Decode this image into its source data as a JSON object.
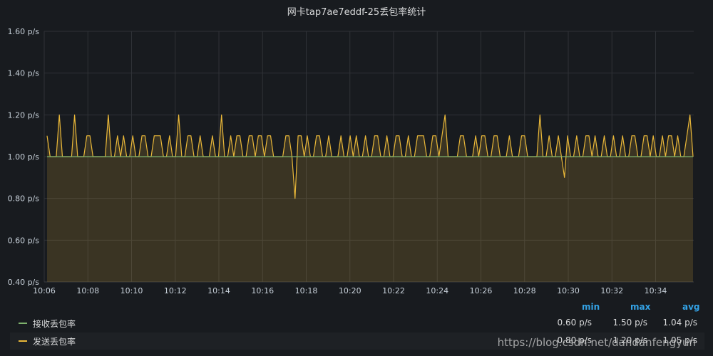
{
  "panel": {
    "title": "网卡tap7ae7eddf-25丢包率统计"
  },
  "chart_data": {
    "type": "line",
    "y_unit_suffix": " p/s",
    "ylim": [
      0.4,
      1.6
    ],
    "yticks": [
      "1.60 p/s",
      "1.40 p/s",
      "1.20 p/s",
      "1.00 p/s",
      "0.80 p/s",
      "0.60 p/s",
      "0.40 p/s"
    ],
    "ytick_values": [
      1.6,
      1.4,
      1.2,
      1.0,
      0.8,
      0.6,
      0.4
    ],
    "xticks": [
      "10:06",
      "10:08",
      "10:10",
      "10:12",
      "10:14",
      "10:16",
      "10:18",
      "10:20",
      "10:22",
      "10:24",
      "10:26",
      "10:28",
      "10:30",
      "10:32",
      "10:34"
    ],
    "grid": true,
    "series": [
      {
        "name": "接收丢包率",
        "color": "#7eb26d",
        "fill": false,
        "values": [
          1.0,
          1.0,
          1.0,
          1.0,
          1.0,
          1.0,
          1.0,
          1.0,
          1.0,
          1.0,
          1.0,
          1.0,
          1.0,
          1.0,
          1.0,
          1.0,
          1.0,
          1.0,
          1.0,
          1.0,
          1.0,
          1.0,
          1.0,
          1.0,
          1.0,
          1.0,
          1.0,
          1.0,
          1.0,
          1.0,
          1.0,
          1.0,
          1.0,
          1.0,
          1.0,
          1.0,
          1.0,
          1.0,
          1.0,
          1.0,
          1.0,
          1.0,
          1.0,
          1.0,
          1.0,
          1.0,
          1.0,
          1.0,
          1.0,
          1.0,
          1.0,
          1.0,
          1.0,
          1.0,
          1.0,
          1.0,
          1.0,
          1.0,
          1.0,
          1.0,
          1.0,
          1.0,
          1.0,
          1.0,
          1.0,
          1.0,
          1.0,
          1.0,
          1.0,
          1.0,
          1.0,
          1.0,
          1.0,
          1.0,
          1.0,
          1.0,
          1.0,
          1.0,
          1.0,
          1.0,
          1.0,
          1.0,
          1.0,
          1.0,
          1.0,
          1.0,
          1.0,
          1.0,
          1.0,
          1.0,
          1.0,
          1.0,
          1.0,
          1.0,
          1.0,
          1.0,
          1.0,
          1.0,
          1.0,
          1.0,
          1.0,
          1.0,
          1.0,
          1.0,
          1.0,
          1.0,
          1.0,
          1.0,
          1.0,
          1.0,
          1.0,
          1.0,
          1.0,
          1.0,
          1.0,
          1.0,
          1.0,
          1.0,
          1.0,
          1.0,
          1.0,
          1.0,
          1.0,
          1.0,
          1.0,
          1.0,
          1.0,
          1.0,
          1.0,
          1.0,
          1.0,
          1.0,
          1.0,
          1.0,
          1.0,
          1.0,
          1.0,
          1.0,
          1.0,
          1.0,
          1.0,
          1.0,
          1.0,
          1.0,
          1.0,
          1.0,
          1.0,
          1.0,
          1.0,
          1.0,
          1.0,
          1.0,
          1.0,
          1.0,
          1.0,
          1.0,
          1.0,
          1.0,
          1.0,
          1.0,
          1.0,
          1.0,
          1.0,
          1.0,
          1.0,
          1.0,
          1.0,
          1.0,
          1.0,
          1.0,
          1.0,
          1.0,
          1.0,
          1.0,
          1.0,
          1.0,
          1.0,
          1.0,
          1.0,
          1.0,
          1.0,
          1.0
        ]
      },
      {
        "name": "发送丢包率",
        "color": "#eab839",
        "fill": true,
        "values": [
          1.1,
          1.0,
          1.0,
          1.0,
          1.2,
          1.0,
          1.0,
          1.0,
          1.0,
          1.2,
          1.0,
          1.0,
          1.0,
          1.1,
          1.1,
          1.0,
          1.0,
          1.0,
          1.0,
          1.0,
          1.2,
          1.0,
          1.0,
          1.1,
          1.0,
          1.1,
          1.0,
          1.0,
          1.1,
          1.0,
          1.0,
          1.1,
          1.1,
          1.0,
          1.0,
          1.1,
          1.1,
          1.1,
          1.0,
          1.0,
          1.1,
          1.0,
          1.0,
          1.2,
          1.0,
          1.0,
          1.1,
          1.1,
          1.0,
          1.0,
          1.1,
          1.0,
          1.0,
          1.0,
          1.1,
          1.0,
          1.0,
          1.2,
          1.0,
          1.0,
          1.1,
          1.0,
          1.1,
          1.1,
          1.0,
          1.0,
          1.1,
          1.1,
          1.0,
          1.1,
          1.1,
          1.0,
          1.1,
          1.1,
          1.0,
          1.0,
          1.0,
          1.0,
          1.1,
          1.1,
          1.0,
          0.8,
          1.1,
          1.1,
          1.0,
          1.1,
          1.0,
          1.0,
          1.1,
          1.1,
          1.0,
          1.0,
          1.1,
          1.0,
          1.0,
          1.0,
          1.1,
          1.0,
          1.0,
          1.1,
          1.0,
          1.1,
          1.0,
          1.0,
          1.1,
          1.0,
          1.0,
          1.1,
          1.1,
          1.0,
          1.0,
          1.1,
          1.0,
          1.0,
          1.1,
          1.1,
          1.0,
          1.0,
          1.1,
          1.0,
          1.0,
          1.1,
          1.1,
          1.1,
          1.0,
          1.0,
          1.1,
          1.1,
          1.0,
          1.1,
          1.2,
          1.0,
          1.0,
          1.0,
          1.0,
          1.1,
          1.1,
          1.0,
          1.0,
          1.0,
          1.1,
          1.0,
          1.1,
          1.1,
          1.0,
          1.0,
          1.1,
          1.1,
          1.0,
          1.0,
          1.0,
          1.1,
          1.0,
          1.0,
          1.0,
          1.1,
          1.1,
          1.0,
          1.0,
          1.0,
          1.0,
          1.2,
          1.0,
          1.0,
          1.1,
          1.0,
          1.0,
          1.1,
          1.0,
          0.9,
          1.1,
          1.0,
          1.0,
          1.1,
          1.0,
          1.0,
          1.1,
          1.1,
          1.0,
          1.1,
          1.0,
          1.0,
          1.1,
          1.0,
          1.0,
          1.1,
          1.0,
          1.0,
          1.1,
          1.0,
          1.0,
          1.1,
          1.1,
          1.0,
          1.0,
          1.1,
          1.1,
          1.0,
          1.1,
          1.0,
          1.0,
          1.1,
          1.0,
          1.1,
          1.1,
          1.0,
          1.1,
          1.0,
          1.0,
          1.1,
          1.2,
          1.0
        ]
      }
    ]
  },
  "legend": {
    "headers": {
      "min": "min",
      "max": "max",
      "avg": "avg"
    },
    "rows": [
      {
        "name": "接收丢包率",
        "color": "#7eb26d",
        "min": "0.60 p/s",
        "max": "1.50 p/s",
        "avg": "1.04 p/s"
      },
      {
        "name": "发送丢包率",
        "color": "#eab839",
        "min": "0.80 p/s",
        "max": "1.20 p/s",
        "avg": "1.05 p/s"
      }
    ]
  },
  "watermark": "https://blog.csdn.net/dandanfengyun"
}
